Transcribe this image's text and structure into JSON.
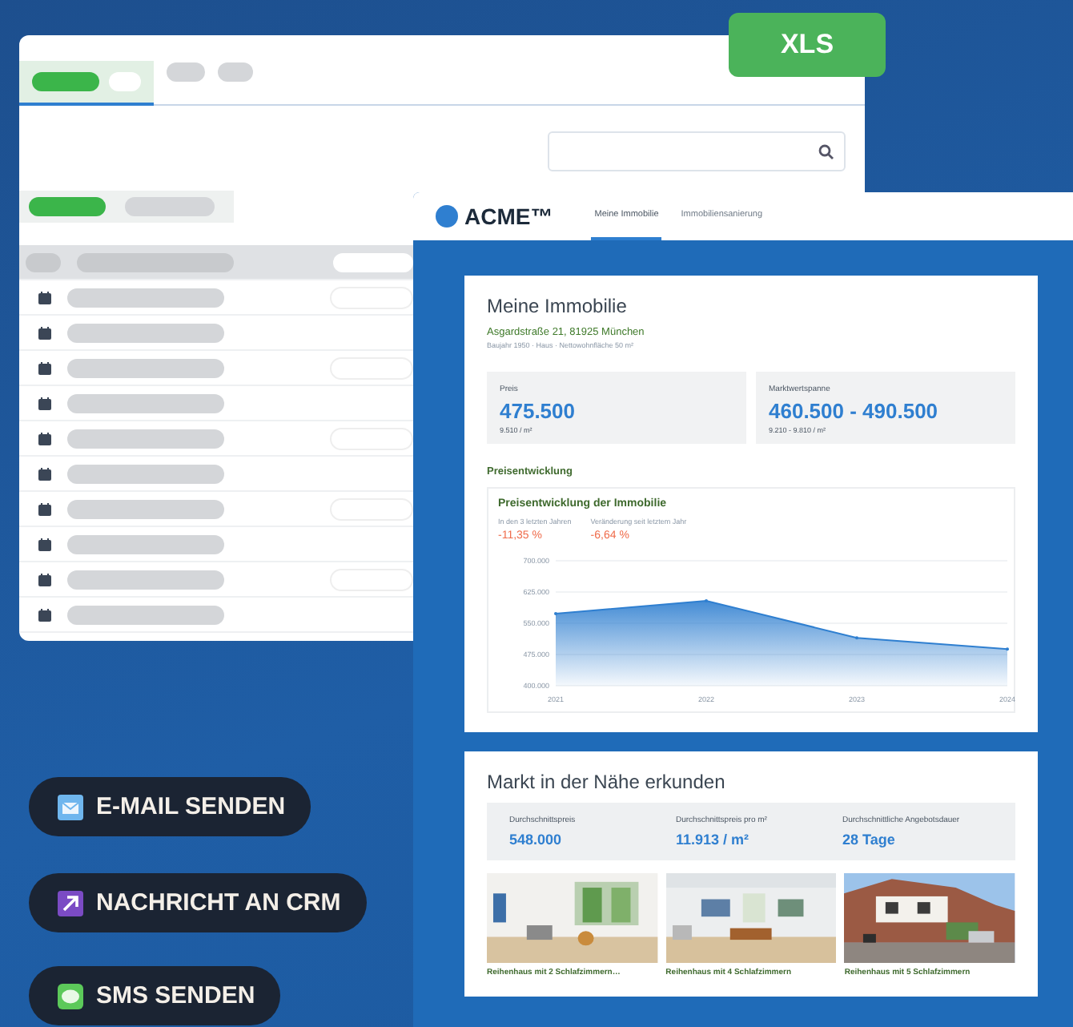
{
  "export_badge": "XLS",
  "app": {
    "logo": "ACME™",
    "tabs": [
      {
        "label": "Meine Immobilie",
        "selected": true
      },
      {
        "label": "Immobiliensanierung",
        "selected": false
      }
    ]
  },
  "property": {
    "title": "Meine Immobilie",
    "address": "Asgardstraße 21, 81925 München",
    "details": "Baujahr 1950 · Haus · Nettowohnfläche 50 m²",
    "stats": [
      {
        "label": "Preis",
        "value": "475.500",
        "sub": "9.510 / m²"
      },
      {
        "label": "Marktwertspanne",
        "value": "460.500 - 490.500",
        "sub": "9.210 - 9.810 / m²"
      }
    ],
    "section": "Preisentwicklung",
    "chart_card": {
      "title": "Preisentwicklung der Immobilie",
      "changes": [
        {
          "label": "In den 3 letzten Jahren",
          "value": "-11,35 %"
        },
        {
          "label": "Veränderung seit letztem Jahr",
          "value": "-6,64 %"
        }
      ],
      "chart_data": {
        "type": "area",
        "categories": [
          "2021",
          "2022",
          "2023",
          "2024"
        ],
        "series": [
          {
            "color": "#2f7fd0",
            "values": [
              573000,
              604000,
              515000,
              488000
            ]
          }
        ],
        "grid": true,
        "ylim": [
          400000,
          700000
        ],
        "yticks": [
          {
            "value": 400000,
            "label": "400.000"
          },
          {
            "value": 475000,
            "label": "475.000"
          },
          {
            "value": 550000,
            "label": "550.000"
          },
          {
            "value": 625000,
            "label": "625.000"
          },
          {
            "value": 700000,
            "label": "700.000"
          }
        ]
      }
    }
  },
  "market": {
    "title": "Markt in der Nähe erkunden",
    "stats": [
      {
        "label": "Durchschnittspreis",
        "value": "548.000"
      },
      {
        "label": "Durchschnittspreis pro m²",
        "value": "11.913 / m²"
      },
      {
        "label": "Durchschnittliche Angebotsdauer",
        "value": "28 Tage"
      }
    ],
    "listings": [
      {
        "kind": "interior",
        "title": "Reihenhaus mit 2 Schlafzimmern…"
      },
      {
        "kind": "gallery",
        "title": "Reihenhaus mit 4 Schlafzimmern"
      },
      {
        "kind": "house",
        "title": "Reihenhaus mit 5 Schlafzimmern"
      }
    ]
  },
  "actions": [
    {
      "kind": "email",
      "label": "E-MAIL SENDEN"
    },
    {
      "kind": "crm",
      "label": "NACHRICHT AN CRM"
    },
    {
      "kind": "sms",
      "label": "SMS SENDEN"
    }
  ]
}
